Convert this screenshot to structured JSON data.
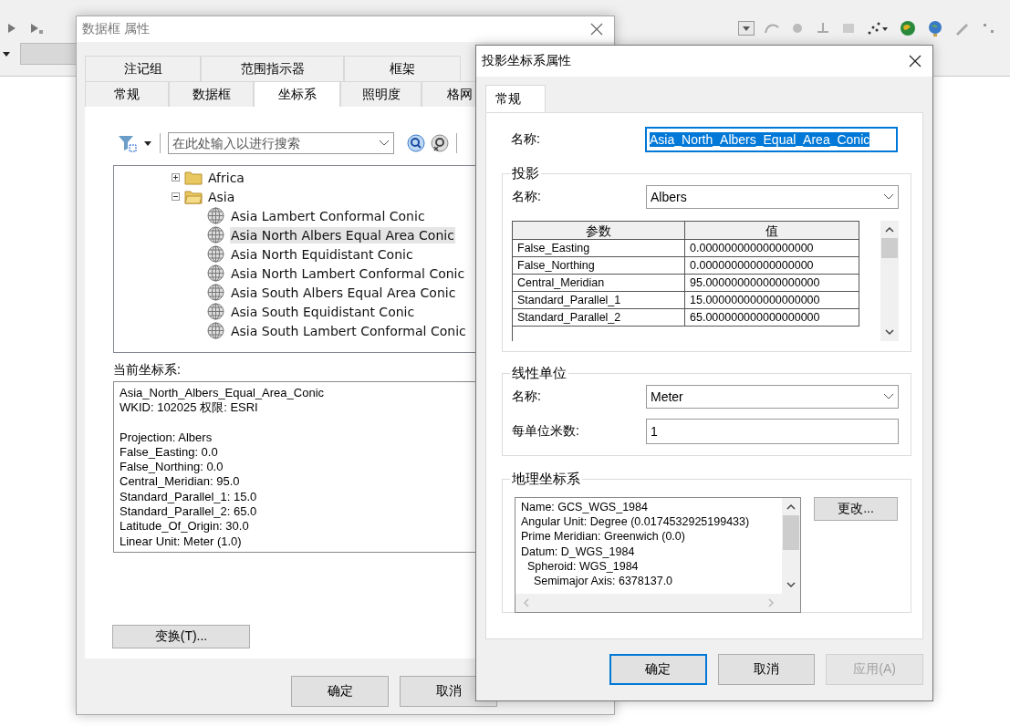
{
  "data_frame_dialog": {
    "title": "数据框 属性",
    "tab_rows": [
      [
        {
          "label": "注记组",
          "selected": false
        },
        {
          "label": "范围指示器",
          "selected": false
        },
        {
          "label": "框架",
          "selected": false
        }
      ],
      [
        {
          "label": "常规",
          "selected": false
        },
        {
          "label": "数据框",
          "selected": false
        },
        {
          "label": "坐标系",
          "selected": true
        },
        {
          "label": "照明度",
          "selected": false
        },
        {
          "label": "格网",
          "selected": false
        }
      ]
    ],
    "search": {
      "placeholder": "在此处输入以进行搜索"
    },
    "tree": [
      {
        "label": "Africa",
        "expanded": false
      },
      {
        "label": "Asia",
        "expanded": true,
        "children": [
          {
            "label": "Asia Lambert Conformal Conic",
            "selected": false
          },
          {
            "label": "Asia North Albers Equal Area Conic",
            "selected": true
          },
          {
            "label": "Asia North Equidistant Conic",
            "selected": false
          },
          {
            "label": "Asia North Lambert Conformal Conic",
            "selected": false
          },
          {
            "label": "Asia South Albers Equal Area Conic",
            "selected": false
          },
          {
            "label": "Asia South Equidistant Conic",
            "selected": false
          },
          {
            "label": "Asia South Lambert Conformal Conic",
            "selected": false
          }
        ]
      }
    ],
    "current_label": "当前坐标系:",
    "current_text": [
      [
        "Asia_North_Albers_Equal_Area_Conic",
        "WKID: 102025 权限: ESRI"
      ],
      [
        "Projection: Albers",
        "False_Easting: 0.0",
        "False_Northing: 0.0",
        "Central_Meridian: 95.0",
        "Standard_Parallel_1: 15.0",
        "Standard_Parallel_2: 65.0",
        "Latitude_Of_Origin: 30.0",
        "Linear Unit: Meter (1.0)"
      ]
    ],
    "transform_button": "变换(T)...",
    "buttons": [
      {
        "label": "确定",
        "focused": false,
        "disabled": false
      },
      {
        "label": "取消",
        "focused": false,
        "disabled": false
      }
    ]
  },
  "projected_dialog": {
    "title": "投影坐标系属性",
    "tabs": [
      {
        "label": "常规",
        "selected": true
      }
    ],
    "name_label": "名称:",
    "name_value": "Asia_North_Albers_Equal_Area_Conic",
    "projection": {
      "title": "投影",
      "name_label": "名称:",
      "name_value": "Albers",
      "columns": [
        "参数",
        "值"
      ],
      "rows": [
        [
          "False_Easting",
          "0.000000000000000000"
        ],
        [
          "False_Northing",
          "0.000000000000000000"
        ],
        [
          "Central_Meridian",
          "95.000000000000000000"
        ],
        [
          "Standard_Parallel_1",
          "15.000000000000000000"
        ],
        [
          "Standard_Parallel_2",
          "65.000000000000000000"
        ]
      ]
    },
    "linear_unit": {
      "title": "线性单位",
      "name_label": "名称:",
      "name_value": "Meter",
      "meters_label": "每单位米数:",
      "meters_value": "1"
    },
    "gcs": {
      "title": "地理坐标系",
      "lines": [
        "Name: GCS_WGS_1984",
        "Angular Unit: Degree (0.0174532925199433)",
        "Prime Meridian: Greenwich (0.0)",
        "Datum: D_WGS_1984",
        "  Spheroid: WGS_1984",
        "    Semimajor Axis: 6378137.0"
      ],
      "change_button": "更改..."
    },
    "buttons": [
      {
        "label": "确定",
        "focused": true,
        "disabled": false
      },
      {
        "label": "取消",
        "focused": false,
        "disabled": false
      },
      {
        "label": "应用(A)",
        "focused": false,
        "disabled": true
      }
    ]
  }
}
